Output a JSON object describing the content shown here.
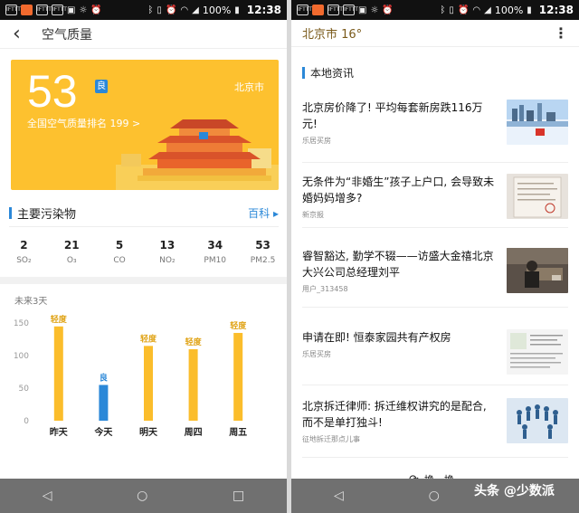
{
  "left": {
    "status": {
      "icons": [
        "IFTTT",
        "IFTTT",
        "IFTTT"
      ],
      "battery": "100%",
      "time": "12:38"
    },
    "toolbar": {
      "back_icon": "back-arrow-icon",
      "title": "空气质量"
    },
    "aqi": {
      "value": "53",
      "level": "良",
      "city": "北京市",
      "rank_text": "全国空气质量排名 199 >"
    },
    "pollutants_section": {
      "title": "主要污染物",
      "link": "百科"
    },
    "pollutants": [
      {
        "value": "2",
        "name": "SO₂"
      },
      {
        "value": "21",
        "name": "O₃"
      },
      {
        "value": "5",
        "name": "CO"
      },
      {
        "value": "13",
        "name": "NO₂"
      },
      {
        "value": "34",
        "name": "PM10"
      },
      {
        "value": "53",
        "name": "PM2.5"
      }
    ],
    "forecast_label": "未来3天",
    "chart_data": {
      "type": "bar",
      "categories": [
        "昨天",
        "今天",
        "明天",
        "周四",
        "周五"
      ],
      "values": [
        145,
        55,
        115,
        110,
        135
      ],
      "labels": [
        "轻度",
        "良",
        "轻度",
        "轻度",
        "轻度"
      ],
      "y_ticks": [
        0,
        50,
        100,
        150
      ],
      "ylim": [
        0,
        160
      ],
      "colors": {
        "bar": "#fbbd2b",
        "highlight": "#2b88d8",
        "label": "#e0a418"
      }
    }
  },
  "right": {
    "status": {
      "icons": [
        "IFTTT",
        "IFTTT",
        "IFTTT"
      ],
      "battery": "100%",
      "time": "12:38"
    },
    "toolbar": {
      "title": "北京市 16°",
      "more_icon": "more-vertical-icon"
    },
    "section_title": "本地资讯",
    "news": [
      {
        "title": "北京房价降了! 平均每套新房跌116万元!",
        "source": "乐居买房"
      },
      {
        "title": "无条件为“非婚生”孩子上户口, 会导致未婚妈妈增多?",
        "source": "新京报"
      },
      {
        "title": "睿智豁达, 勤学不辍——访盛大金禧北京大兴公司总经理刘平",
        "source": "用户_313458"
      },
      {
        "title": "申请在即! 恒泰家园共有产权房",
        "source": "乐居买房"
      },
      {
        "title": "北京拆迁律师: 拆迁维权讲究的是配合, 而不是单打独斗!",
        "source": "征地拆迁那点儿事"
      }
    ],
    "refresh_label": "换一换",
    "watermark": "头条 @少数派"
  },
  "colors": {
    "accent": "#2b88d8",
    "card": "#fdc12f"
  }
}
